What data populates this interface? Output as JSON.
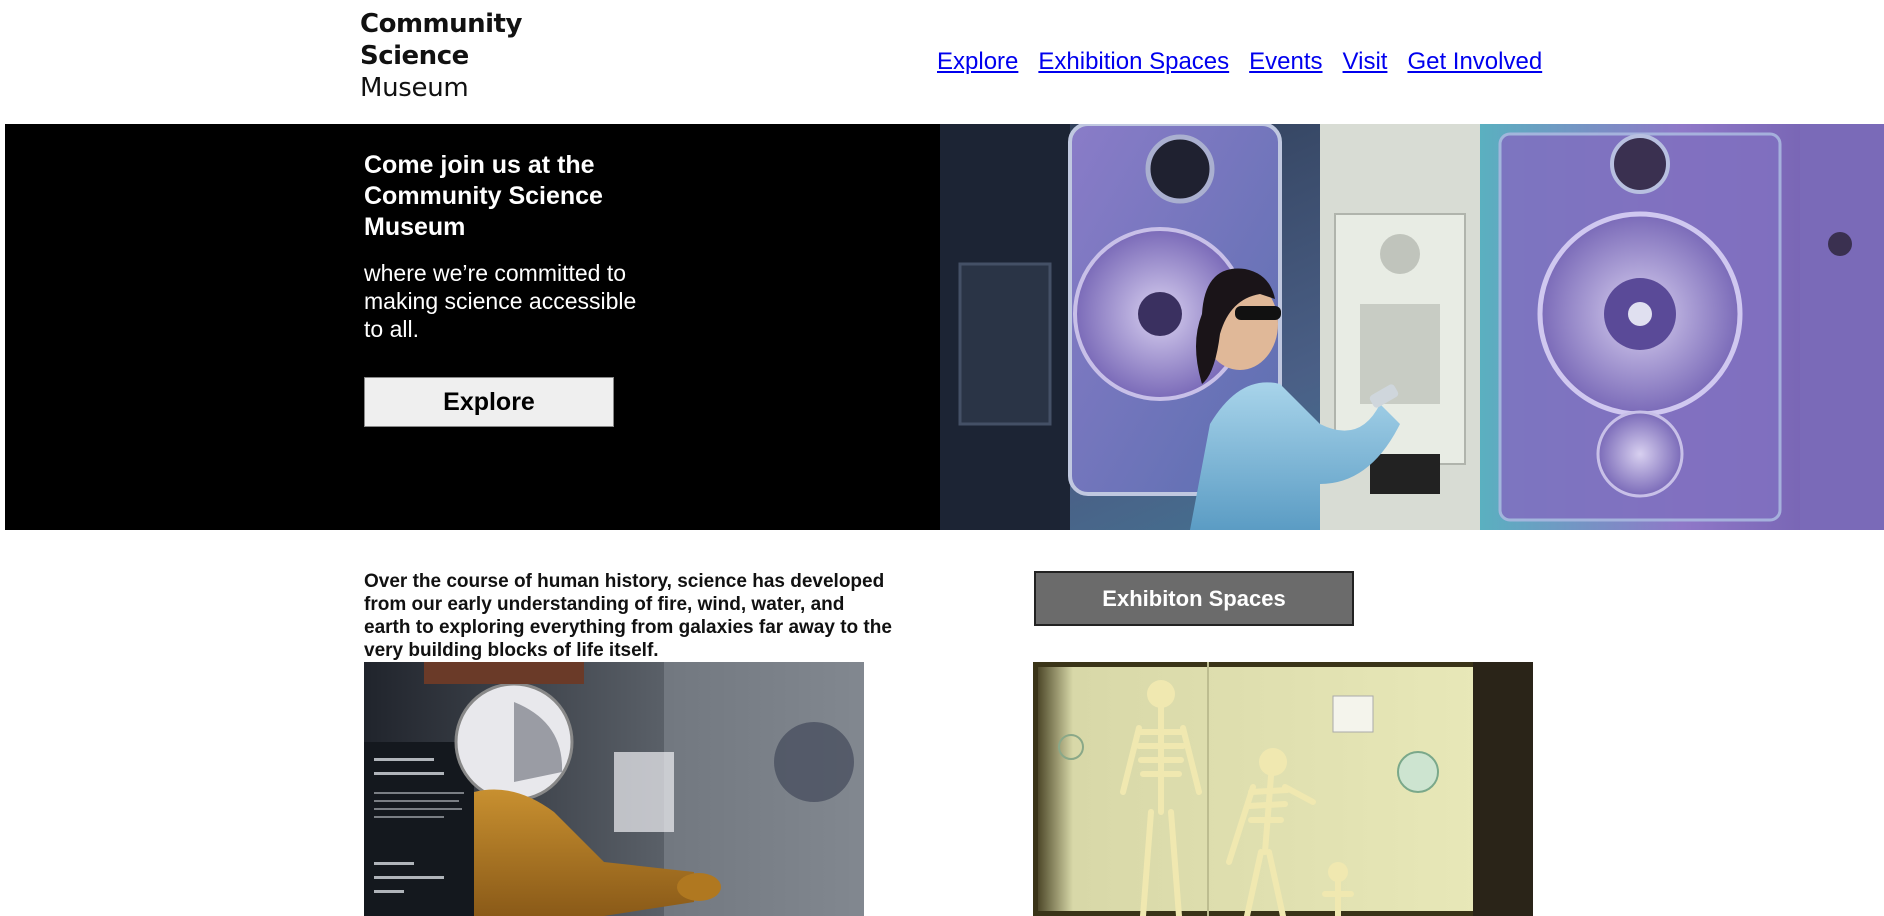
{
  "logo": {
    "line1": "Community",
    "line2": "Science",
    "line3": "Museum"
  },
  "nav": {
    "items": [
      "Explore",
      "Exhibition Spaces",
      "Events",
      "Visit",
      "Get Involved"
    ]
  },
  "hero": {
    "title": "Come join us at the Community Science Museum",
    "subtitle": "where we’re committed to making science accessible to all.",
    "button_label": "Explore",
    "image_icon": "scientist-lab-photo"
  },
  "intro": {
    "text": "Over the course of human history, science has developed from our early understanding of fire, wind, water, and earth to exploring everything from galaxies far away to the very building blocks of life itself."
  },
  "exhibition": {
    "button_label": "Exhibiton Spaces"
  },
  "images": {
    "left_icon": "astronaut-exhibit-photo",
    "right_icon": "skeleton-exhibit-photo"
  },
  "colors": {
    "hero_bg": "#000000",
    "link": "#0000ee",
    "exh_button": "#6b6b6b"
  }
}
